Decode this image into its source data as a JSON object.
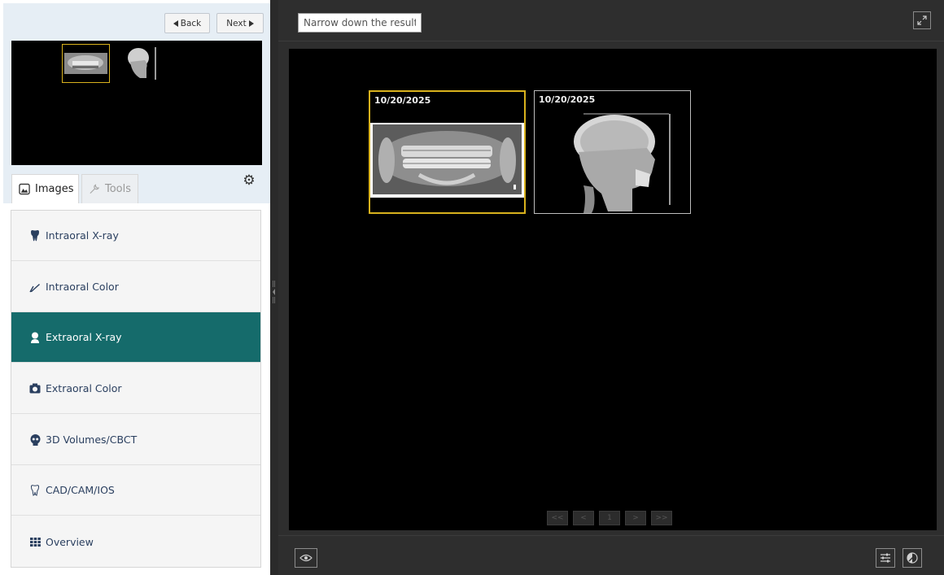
{
  "nav": {
    "back_label": "Back",
    "next_label": "Next"
  },
  "tabs": {
    "images_label": "Images",
    "tools_label": "Tools"
  },
  "menu": {
    "items": [
      {
        "label": "Intraoral X-ray",
        "icon": "tooth-icon",
        "active": false
      },
      {
        "label": "Intraoral Color",
        "icon": "intraoral-camera-icon",
        "active": false
      },
      {
        "label": "Extraoral X-ray",
        "icon": "person-icon",
        "active": true
      },
      {
        "label": "Extraoral Color",
        "icon": "camera-icon",
        "active": false
      },
      {
        "label": "3D Volumes/CBCT",
        "icon": "skull-icon",
        "active": false
      },
      {
        "label": "CAD/CAM/IOS",
        "icon": "tooth-outline-icon",
        "active": false
      },
      {
        "label": "Overview",
        "icon": "grid-icon",
        "active": false
      }
    ]
  },
  "viewer": {
    "filter_placeholder": "Narrow down the results",
    "cards": [
      {
        "date": "10/20/2025",
        "kind": "panoramic",
        "selected": true
      },
      {
        "date": "10/20/2025",
        "kind": "cephalometric",
        "selected": false
      }
    ],
    "pager": {
      "first": "<<",
      "prev": "<",
      "page": "1",
      "next": ">",
      "last": ">>"
    }
  },
  "colors": {
    "active_menu": "#156b6b",
    "selection": "#d9b21d",
    "viewer_bg": "#2e2e2e"
  }
}
